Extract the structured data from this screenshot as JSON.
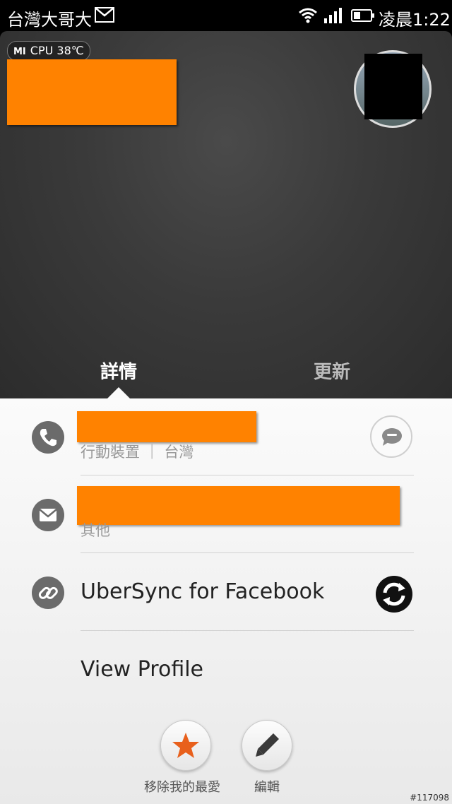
{
  "status_bar": {
    "carrier": "台灣大哥大",
    "time": "凌晨1:22",
    "icons": [
      "mail-icon",
      "wifi-icon",
      "signal-icon",
      "battery-icon"
    ]
  },
  "header": {
    "cpu_badge": {
      "brand": "MI",
      "text": "CPU 38℃"
    },
    "tabs": [
      {
        "label": "詳情",
        "selected": true
      },
      {
        "label": "更新",
        "selected": false
      }
    ]
  },
  "details": {
    "phone": {
      "type_label": "行動裝置 ｜ 台灣",
      "icon": "phone-icon",
      "action_icon": "message-icon"
    },
    "email": {
      "type_label": "其他",
      "icon": "mail-icon"
    },
    "sync": {
      "label": "UberSync for Facebook",
      "icon": "link-icon",
      "app_icon": "sync-icon"
    },
    "view_profile": "View Profile"
  },
  "actions": [
    {
      "label": "移除我的最愛",
      "icon": "star-icon",
      "icon_color": "#e8601c"
    },
    {
      "label": "編輯",
      "icon": "pencil-icon"
    }
  ],
  "watermark": "#117098",
  "colors": {
    "redaction": "#ff8200",
    "header_bg": "#3a3a3a"
  }
}
